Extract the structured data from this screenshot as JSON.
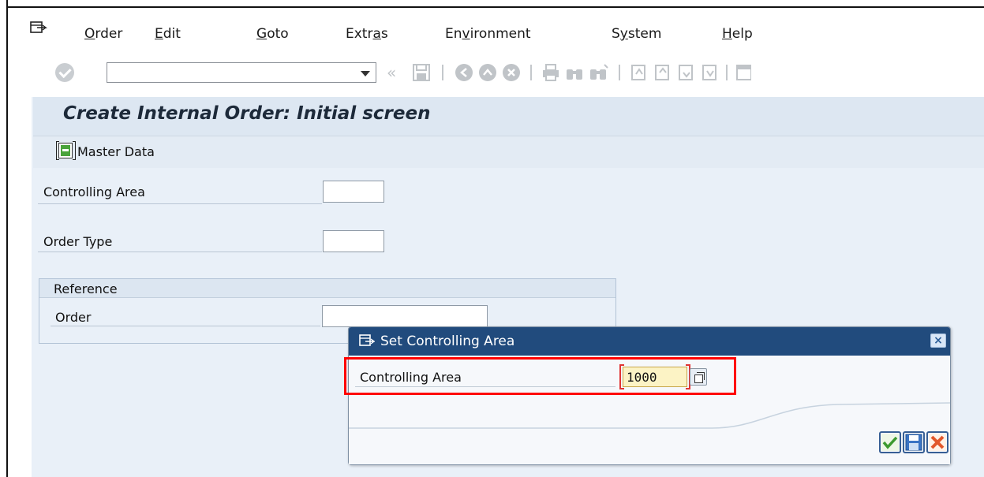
{
  "menu": {
    "items": [
      "Order",
      "Edit",
      "Goto",
      "Extras",
      "Environment",
      "System",
      "Help"
    ]
  },
  "toolbar": {
    "command_field_value": ""
  },
  "page": {
    "title": "Create Internal Order: Initial screen",
    "master_data_label": "Master Data"
  },
  "form": {
    "controlling_area_label": "Controlling Area",
    "controlling_area_value": "",
    "order_type_label": "Order Type",
    "order_type_value": "",
    "reference_group_label": "Reference",
    "order_label": "Order",
    "order_value": ""
  },
  "dialog": {
    "title": "Set Controlling Area",
    "field_label": "Controlling Area",
    "field_value": "1000",
    "close_symbol": "×"
  },
  "colors": {
    "dialog_title_bg": "#214b7d",
    "highlight": "#ff0000",
    "input_highlight_bg": "#fcf3c5",
    "main_bg": "#e9f0f8"
  }
}
